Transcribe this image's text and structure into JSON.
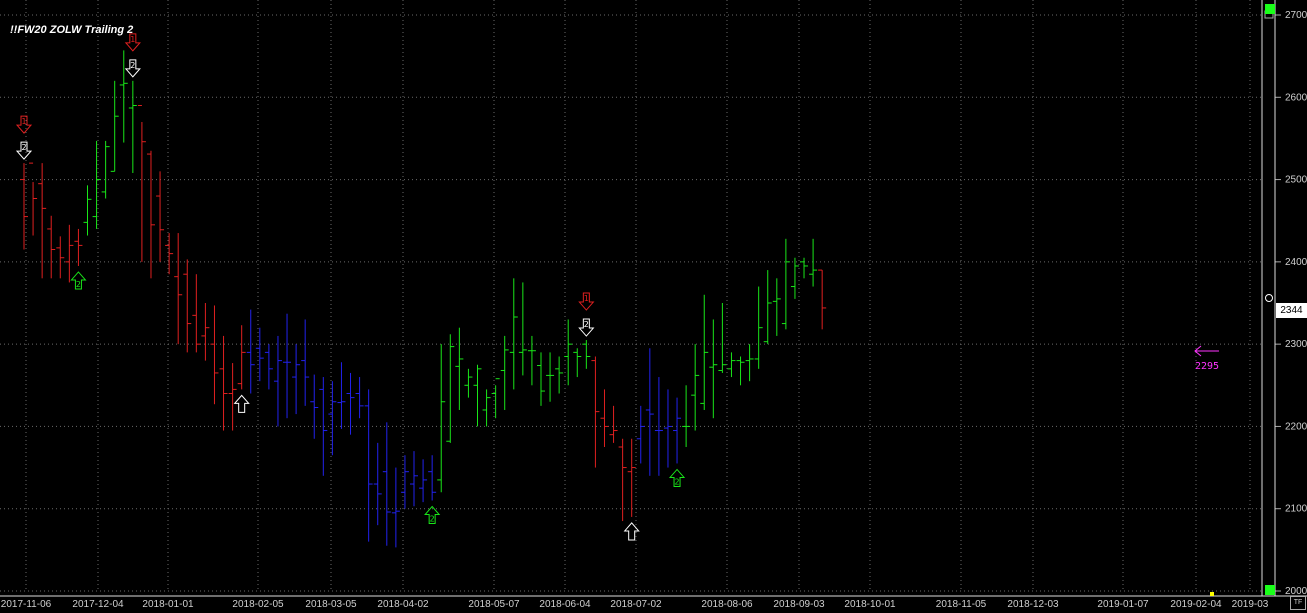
{
  "study_title": "!!FW20 ZOLW Trailing 2",
  "last_price_label": "2344",
  "target_label": "2295",
  "tf_label": "TF",
  "colors": {
    "background": "#000000",
    "grid": "#6a6a6a",
    "axis_text": "#d0d0d0",
    "bar_red": "#e02020",
    "bar_green": "#19e619",
    "bar_blue": "#2222ee",
    "signal_red": "#e02020",
    "signal_white": "#ffffff",
    "signal_green": "#19e619",
    "target_magenta": "#ff33ff"
  },
  "chart_data": {
    "type": "ohlc",
    "ylim": [
      2000,
      2700
    ],
    "y_ticks": [
      "2000",
      "2100",
      "2200",
      "2300",
      "2400",
      "2500",
      "2600",
      "2700"
    ],
    "x_tick_labels": [
      "2017-11-06",
      "2017-12-04",
      "2018-01-01",
      "2018-02-05",
      "2018-03-05",
      "2018-04-02",
      "2018-05-07",
      "2018-06-04",
      "2018-07-02",
      "2018-08-06",
      "2018-09-03",
      "2018-10-01",
      "2018-11-05",
      "2018-12-03",
      "2019-01-07",
      "2019-02-04",
      "2019-03"
    ],
    "last_price": 2344,
    "target_price": 2295,
    "bars": [
      {
        "o": 2500,
        "h": 2520,
        "l": 2415,
        "c": 2455,
        "color": "red"
      },
      {
        "o": 2520,
        "h": 2497,
        "l": 2432,
        "c": 2477,
        "color": "red"
      },
      {
        "o": 2495,
        "h": 2520,
        "l": 2380,
        "c": 2465,
        "color": "red"
      },
      {
        "o": 2440,
        "h": 2456,
        "l": 2380,
        "c": 2415,
        "color": "red"
      },
      {
        "o": 2417,
        "h": 2431,
        "l": 2380,
        "c": 2405,
        "color": "red"
      },
      {
        "o": 2400,
        "h": 2445,
        "l": 2375,
        "c": 2420,
        "color": "red"
      },
      {
        "o": 2425,
        "h": 2440,
        "l": 2395,
        "c": 2420,
        "color": "red"
      },
      {
        "o": 2448,
        "h": 2493,
        "l": 2432,
        "c": 2476,
        "color": "green"
      },
      {
        "o": 2455,
        "h": 2547,
        "l": 2440,
        "c": 2500,
        "color": "green"
      },
      {
        "o": 2485,
        "h": 2547,
        "l": 2477,
        "c": 2540,
        "color": "green"
      },
      {
        "o": 2510,
        "h": 2620,
        "l": 2510,
        "c": 2577,
        "color": "green"
      },
      {
        "o": 2615,
        "h": 2657,
        "l": 2545,
        "c": 2617,
        "color": "green"
      },
      {
        "o": 2587,
        "h": 2620,
        "l": 2508,
        "c": 2590,
        "color": "green"
      },
      {
        "o": 2590,
        "h": 2570,
        "l": 2400,
        "c": 2546,
        "color": "red"
      },
      {
        "o": 2531,
        "h": 2535,
        "l": 2380,
        "c": 2445,
        "color": "red"
      },
      {
        "o": 2480,
        "h": 2510,
        "l": 2400,
        "c": 2439,
        "color": "red"
      },
      {
        "o": 2420,
        "h": 2435,
        "l": 2385,
        "c": 2410,
        "color": "red"
      },
      {
        "o": 2382,
        "h": 2435,
        "l": 2300,
        "c": 2360,
        "color": "red"
      },
      {
        "o": 2385,
        "h": 2403,
        "l": 2290,
        "c": 2325,
        "color": "red"
      },
      {
        "o": 2335,
        "h": 2385,
        "l": 2290,
        "c": 2300,
        "color": "red"
      },
      {
        "o": 2310,
        "h": 2350,
        "l": 2280,
        "c": 2320,
        "color": "red"
      },
      {
        "o": 2300,
        "h": 2347,
        "l": 2227,
        "c": 2265,
        "color": "red"
      },
      {
        "o": 2270,
        "h": 2310,
        "l": 2195,
        "c": 2240,
        "color": "red"
      },
      {
        "o": 2240,
        "h": 2277,
        "l": 2195,
        "c": 2245,
        "color": "red"
      },
      {
        "o": 2252,
        "h": 2323,
        "l": 2245,
        "c": 2290,
        "color": "red"
      },
      {
        "o": 2290,
        "h": 2342,
        "l": 2240,
        "c": 2275,
        "color": "blue"
      },
      {
        "o": 2295,
        "h": 2320,
        "l": 2255,
        "c": 2283,
        "color": "blue"
      },
      {
        "o": 2290,
        "h": 2300,
        "l": 2245,
        "c": 2270,
        "color": "blue"
      },
      {
        "o": 2255,
        "h": 2310,
        "l": 2200,
        "c": 2280,
        "color": "blue"
      },
      {
        "o": 2278,
        "h": 2337,
        "l": 2210,
        "c": 2278,
        "color": "blue"
      },
      {
        "o": 2260,
        "h": 2300,
        "l": 2215,
        "c": 2275,
        "color": "blue"
      },
      {
        "o": 2280,
        "h": 2330,
        "l": 2225,
        "c": 2260,
        "color": "blue"
      },
      {
        "o": 2230,
        "h": 2263,
        "l": 2185,
        "c": 2223,
        "color": "blue"
      },
      {
        "o": 2245,
        "h": 2260,
        "l": 2140,
        "c": 2195,
        "color": "blue"
      },
      {
        "o": 2215,
        "h": 2255,
        "l": 2165,
        "c": 2230,
        "color": "blue"
      },
      {
        "o": 2229,
        "h": 2278,
        "l": 2197,
        "c": 2230,
        "color": "blue"
      },
      {
        "o": 2240,
        "h": 2265,
        "l": 2190,
        "c": 2235,
        "color": "blue"
      },
      {
        "o": 2240,
        "h": 2260,
        "l": 2210,
        "c": 2225,
        "color": "blue"
      },
      {
        "o": 2225,
        "h": 2245,
        "l": 2060,
        "c": 2130,
        "color": "blue"
      },
      {
        "o": 2130,
        "h": 2180,
        "l": 2080,
        "c": 2118,
        "color": "blue"
      },
      {
        "o": 2145,
        "h": 2205,
        "l": 2055,
        "c": 2096,
        "color": "blue"
      },
      {
        "o": 2095,
        "h": 2150,
        "l": 2053,
        "c": 2097,
        "color": "blue"
      },
      {
        "o": 2120,
        "h": 2165,
        "l": 2100,
        "c": 2145,
        "color": "blue"
      },
      {
        "o": 2130,
        "h": 2170,
        "l": 2103,
        "c": 2140,
        "color": "blue"
      },
      {
        "o": 2125,
        "h": 2160,
        "l": 2108,
        "c": 2135,
        "color": "blue"
      },
      {
        "o": 2145,
        "h": 2165,
        "l": 2110,
        "c": 2120,
        "color": "blue"
      },
      {
        "o": 2135,
        "h": 2300,
        "l": 2120,
        "c": 2230,
        "color": "green"
      },
      {
        "o": 2182,
        "h": 2312,
        "l": 2180,
        "c": 2297,
        "color": "green"
      },
      {
        "o": 2273,
        "h": 2320,
        "l": 2220,
        "c": 2282,
        "color": "green"
      },
      {
        "o": 2250,
        "h": 2270,
        "l": 2235,
        "c": 2260,
        "color": "green"
      },
      {
        "o": 2250,
        "h": 2275,
        "l": 2200,
        "c": 2270,
        "color": "green"
      },
      {
        "o": 2220,
        "h": 2245,
        "l": 2200,
        "c": 2235,
        "color": "green"
      },
      {
        "o": 2240,
        "h": 2250,
        "l": 2210,
        "c": 2258,
        "color": "green"
      },
      {
        "o": 2268,
        "h": 2310,
        "l": 2220,
        "c": 2293,
        "color": "green"
      },
      {
        "o": 2290,
        "h": 2380,
        "l": 2245,
        "c": 2333,
        "color": "green"
      },
      {
        "o": 2290,
        "h": 2375,
        "l": 2262,
        "c": 2293,
        "color": "green"
      },
      {
        "o": 2292,
        "h": 2310,
        "l": 2250,
        "c": 2292,
        "color": "green"
      },
      {
        "o": 2274,
        "h": 2290,
        "l": 2225,
        "c": 2243,
        "color": "green"
      },
      {
        "o": 2262,
        "h": 2290,
        "l": 2230,
        "c": 2262,
        "color": "green"
      },
      {
        "o": 2270,
        "h": 2285,
        "l": 2240,
        "c": 2265,
        "color": "green"
      },
      {
        "o": 2285,
        "h": 2330,
        "l": 2250,
        "c": 2300,
        "color": "green"
      },
      {
        "o": 2290,
        "h": 2295,
        "l": 2260,
        "c": 2285,
        "color": "green"
      },
      {
        "o": 2300,
        "h": 2305,
        "l": 2270,
        "c": 2285,
        "color": "green"
      },
      {
        "o": 2280,
        "h": 2285,
        "l": 2150,
        "c": 2218,
        "color": "red"
      },
      {
        "o": 2210,
        "h": 2245,
        "l": 2175,
        "c": 2200,
        "color": "red"
      },
      {
        "o": 2190,
        "h": 2225,
        "l": 2180,
        "c": 2195,
        "color": "red"
      },
      {
        "o": 2175,
        "h": 2185,
        "l": 2085,
        "c": 2150,
        "color": "red"
      },
      {
        "o": 2145,
        "h": 2185,
        "l": 2090,
        "c": 2150,
        "color": "red"
      },
      {
        "o": 2185,
        "h": 2225,
        "l": 2155,
        "c": 2200,
        "color": "blue"
      },
      {
        "o": 2220,
        "h": 2295,
        "l": 2140,
        "c": 2215,
        "color": "blue"
      },
      {
        "o": 2195,
        "h": 2260,
        "l": 2140,
        "c": 2195,
        "color": "blue"
      },
      {
        "o": 2198,
        "h": 2245,
        "l": 2150,
        "c": 2200,
        "color": "blue"
      },
      {
        "o": 2195,
        "h": 2235,
        "l": 2155,
        "c": 2210,
        "color": "blue"
      },
      {
        "o": 2200,
        "h": 2250,
        "l": 2175,
        "c": 2200,
        "color": "green"
      },
      {
        "o": 2238,
        "h": 2300,
        "l": 2195,
        "c": 2262,
        "color": "green"
      },
      {
        "o": 2228,
        "h": 2360,
        "l": 2220,
        "c": 2290,
        "color": "green"
      },
      {
        "o": 2272,
        "h": 2330,
        "l": 2210,
        "c": 2275,
        "color": "green"
      },
      {
        "o": 2268,
        "h": 2350,
        "l": 2265,
        "c": 2275,
        "color": "green"
      },
      {
        "o": 2270,
        "h": 2290,
        "l": 2260,
        "c": 2280,
        "color": "green"
      },
      {
        "o": 2280,
        "h": 2285,
        "l": 2250,
        "c": 2278,
        "color": "green"
      },
      {
        "o": 2280,
        "h": 2300,
        "l": 2255,
        "c": 2282,
        "color": "green"
      },
      {
        "o": 2282,
        "h": 2370,
        "l": 2270,
        "c": 2320,
        "color": "green"
      },
      {
        "o": 2303,
        "h": 2390,
        "l": 2300,
        "c": 2350,
        "color": "green"
      },
      {
        "o": 2352,
        "h": 2380,
        "l": 2310,
        "c": 2355,
        "color": "green"
      },
      {
        "o": 2325,
        "h": 2428,
        "l": 2318,
        "c": 2400,
        "color": "green"
      },
      {
        "o": 2370,
        "h": 2405,
        "l": 2355,
        "c": 2395,
        "color": "green"
      },
      {
        "o": 2400,
        "h": 2405,
        "l": 2380,
        "c": 2395,
        "color": "green"
      },
      {
        "o": 2385,
        "h": 2428,
        "l": 2370,
        "c": 2390,
        "color": "green"
      },
      {
        "o": 2390,
        "h": 2390,
        "l": 2318,
        "c": 2344,
        "color": "red"
      }
    ],
    "signals": [
      {
        "bar": 0,
        "type": "red",
        "dir": "down",
        "label": "1"
      },
      {
        "bar": 0,
        "type": "white",
        "dir": "down",
        "label": "2"
      },
      {
        "bar": 6,
        "type": "green",
        "dir": "up",
        "label": "2"
      },
      {
        "bar": 12,
        "type": "red",
        "dir": "down",
        "label": "1"
      },
      {
        "bar": 12,
        "type": "white",
        "dir": "down",
        "label": "2"
      },
      {
        "bar": 24,
        "type": "white",
        "dir": "up",
        "label": ""
      },
      {
        "bar": 45,
        "type": "green",
        "dir": "up",
        "label": "2"
      },
      {
        "bar": 62,
        "type": "red",
        "dir": "down",
        "label": "1"
      },
      {
        "bar": 62,
        "type": "white",
        "dir": "down",
        "label": "2"
      },
      {
        "bar": 67,
        "type": "white",
        "dir": "up",
        "label": ""
      },
      {
        "bar": 72,
        "type": "green",
        "dir": "up",
        "label": "2"
      }
    ]
  }
}
